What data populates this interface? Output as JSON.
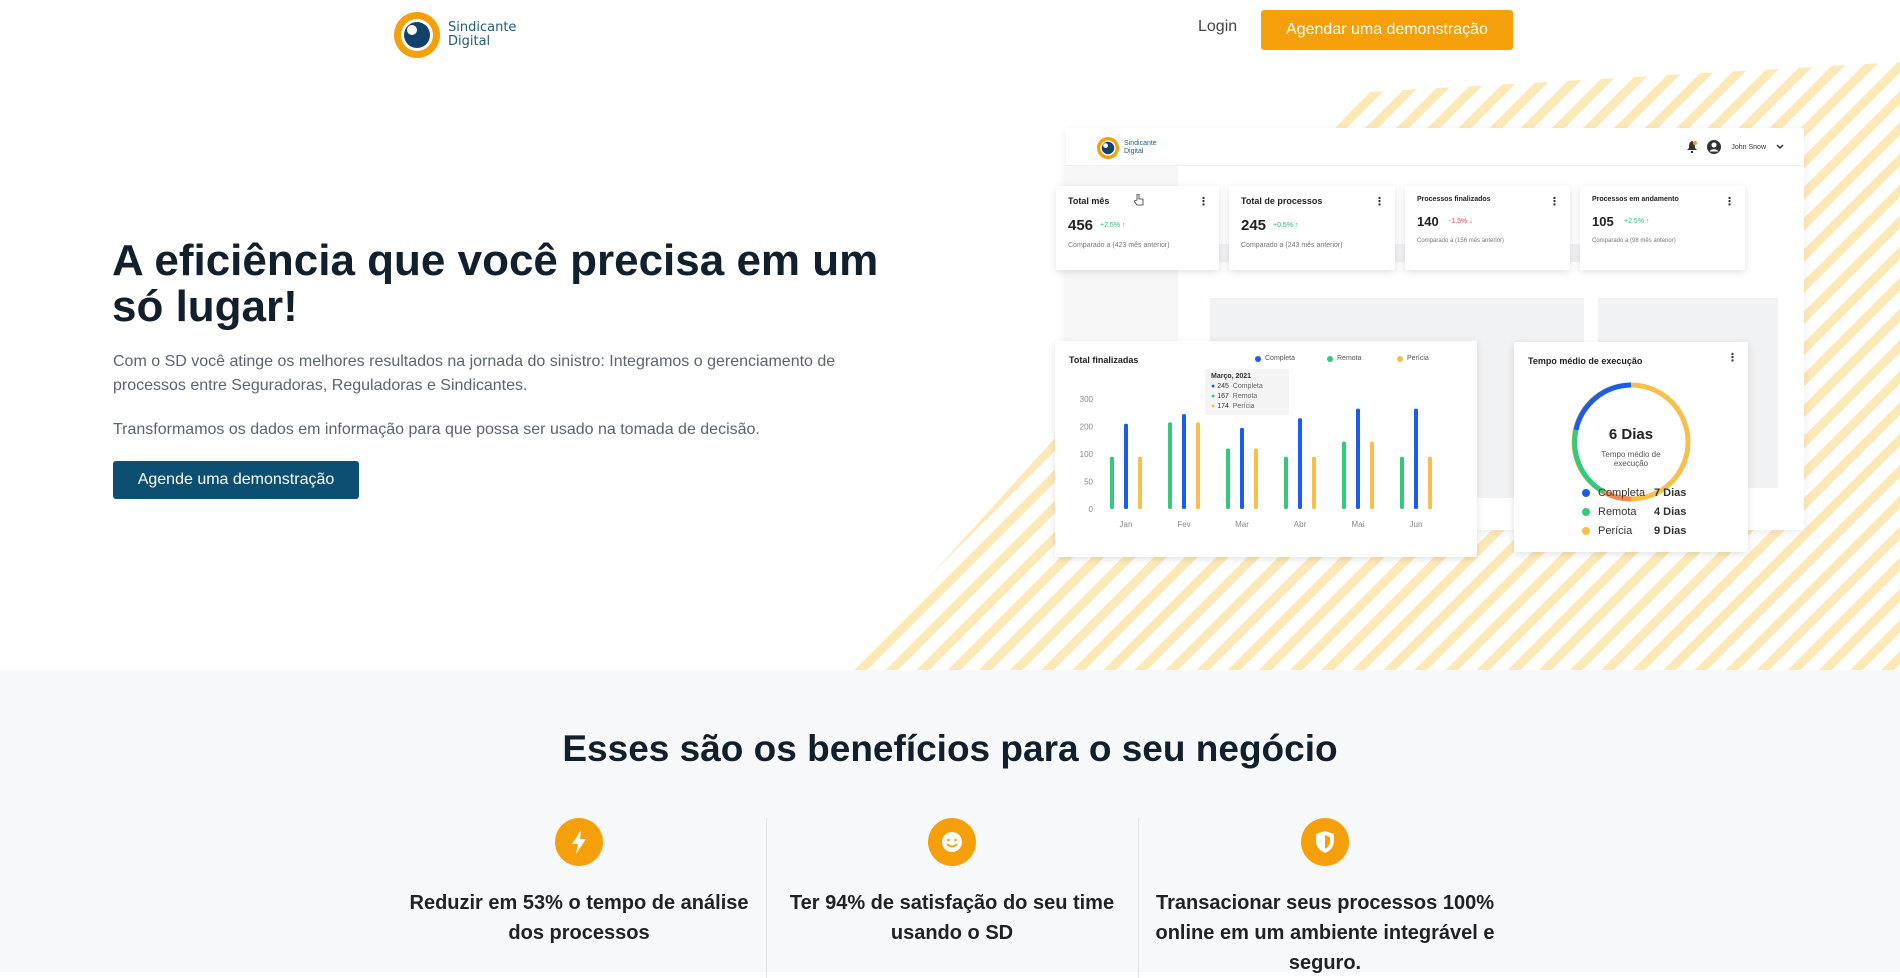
{
  "header": {
    "logo_line1": "Sindicante",
    "logo_line2": "Digital",
    "login_label": "Login",
    "cta_label": "Agendar uma demonstração"
  },
  "hero": {
    "title": "A eficiência que você precisa em um só lugar!",
    "paragraph1": "Com o SD você atinge os melhores resultados na jornada do sinistro: Integramos o gerenciamento de processos entre Seguradoras, Reguladoras e Sindicantes.",
    "paragraph2": "Transformamos os dados em informação para que possa ser usado na tomada de decisão.",
    "cta_label": "Agende uma demonstração"
  },
  "dashboard": {
    "logo_line1": "Sindicante",
    "logo_line2": "Digital",
    "user_name": "John Snow",
    "kpis": [
      {
        "title": "Total mês",
        "value": "456",
        "delta": "+2.5%",
        "trend": "up",
        "comparison": "Comparado a (423 mês anterior)"
      },
      {
        "title": "Total de processos",
        "value": "245",
        "delta": "+0.5%",
        "trend": "up",
        "comparison": "Comparado a (243 mês anterior)"
      },
      {
        "title": "Processos finalizados",
        "value": "140",
        "delta": "-1.5%",
        "trend": "down",
        "comparison": "Comparado a (156 mês anterior)"
      },
      {
        "title": "Processos em andamento",
        "value": "105",
        "delta": "+2.5%",
        "trend": "up",
        "comparison": "Comparado a (98 mês anterior)"
      }
    ],
    "tooltip": {
      "title": "Março, 2021",
      "rows": [
        {
          "value": "245",
          "label": "Completa"
        },
        {
          "value": "167",
          "label": "Remota"
        },
        {
          "value": "174",
          "label": "Perícia"
        }
      ]
    },
    "time_card": {
      "title": "Tempo médio de execução",
      "center_value": "6 Dias",
      "center_label": "Tempo médio de execução",
      "legend": [
        {
          "label": "Completa",
          "value": "7 Dias",
          "color": "#1a5cf0"
        },
        {
          "label": "Remota",
          "value": "4 Dias",
          "color": "#35c97e"
        },
        {
          "label": "Perícia",
          "value": "9 Dias",
          "color": "#f7c04a"
        }
      ]
    }
  },
  "chart_data": {
    "type": "bar",
    "title": "Total finalizadas",
    "categories": [
      "Jan",
      "Fev",
      "Mar",
      "Abr",
      "Mai",
      "Jun"
    ],
    "yticks": [
      "300",
      "200",
      "100",
      "50",
      "0"
    ],
    "ylim": [
      0,
      300
    ],
    "series": [
      {
        "name": "Completa",
        "color": "#1a5cf0",
        "values": [
          210,
          245,
          195,
          230,
          265,
          265
        ]
      },
      {
        "name": "Remota",
        "color": "#35c97e",
        "values": [
          95,
          215,
          120,
          95,
          145,
          95
        ]
      },
      {
        "name": "Perícia",
        "color": "#f7c04a",
        "values": [
          95,
          215,
          120,
          95,
          145,
          95
        ]
      }
    ]
  },
  "benefits": {
    "title": "Esses são os benefícios para o seu negócio",
    "items": [
      {
        "icon": "lightning-icon",
        "text": "Reduzir em 53% o tempo de análise dos processos"
      },
      {
        "icon": "smiley-icon",
        "text": "Ter 94% de satisfação do seu time usando o SD"
      },
      {
        "icon": "shield-icon",
        "text": "Transacionar seus processos 100% online em um ambiente integrável e seguro."
      }
    ]
  },
  "colors": {
    "accent": "#f5a00a",
    "primary": "#0d4f73",
    "stripe": "#fde2a3"
  }
}
